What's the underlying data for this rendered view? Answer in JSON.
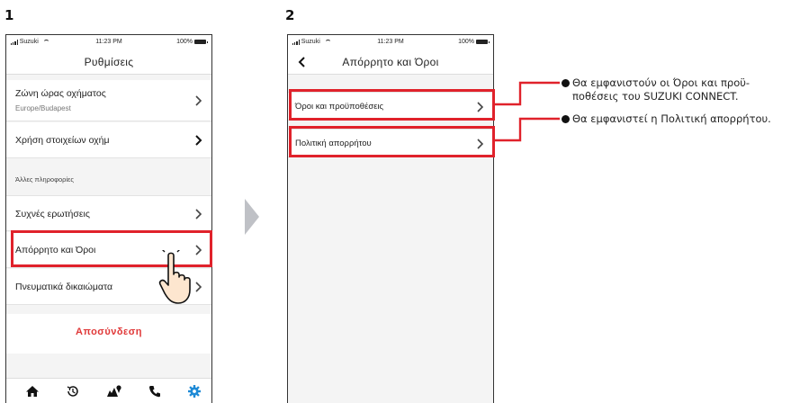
{
  "steps": {
    "one": "1",
    "two": "2"
  },
  "status": {
    "carrier": "Suzuki",
    "time": "11:23 PM",
    "battery": "100%"
  },
  "screen1": {
    "title": "Ρυθμίσεις",
    "timezone_label": "Ζώνη ώρας οχήματος",
    "timezone_value": "Europe/Budapest",
    "vehicle_data_label": "Χρήση στοιχείων οχήμ",
    "other_info_header": "Άλλες πληροφορίες",
    "faq_label": "Συχνές ερωτήσεις",
    "privacy_label": "Απόρρητο και Όροι",
    "ip_label": "Πνευματικά δικαιώματα",
    "logout_label": "Αποσύνδεση",
    "tabs": [
      "home-icon",
      "history-icon",
      "map-icon",
      "phone-icon",
      "settings-icon"
    ],
    "active_tab_color": "#1e8ad6"
  },
  "screen2": {
    "title": "Απόρρητο και Όροι",
    "terms_label": "Όροι και προϋποθέσεις",
    "privacy_policy_label": "Πολιτική απορρήτου"
  },
  "callouts": {
    "terms_line1": "Θα εμφανιστούν οι Όροι και προϋ-",
    "terms_line2": "ποθέσεις του SUZUKI CONNECT.",
    "privacy": "Θα εμφανιστεί η Πολιτική απορρήτου."
  },
  "colors": {
    "highlight": "#e0222b",
    "logout": "#e03838"
  }
}
